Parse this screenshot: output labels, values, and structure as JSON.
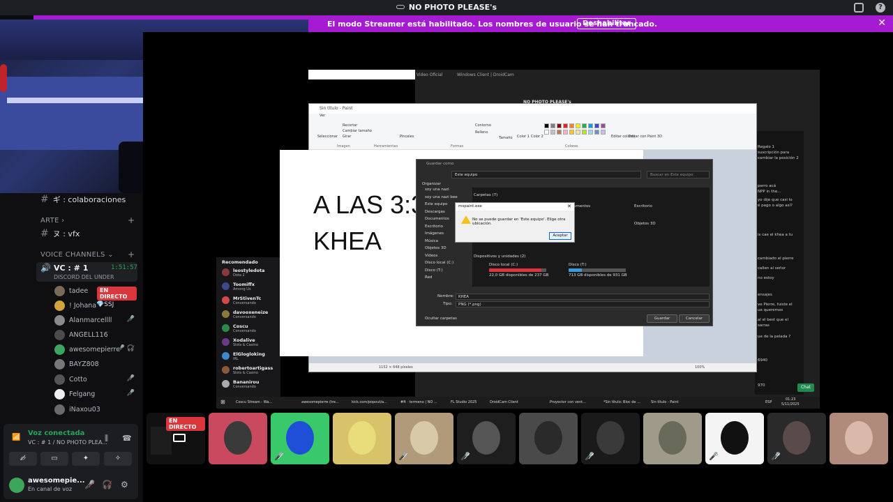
{
  "window": {
    "title": "NO PHOTO PLEASE's"
  },
  "banner": {
    "message": "El modo Streamer está habilitado. Los nombres de usuario se han truncado.",
    "button": "Deshabilitar",
    "close": "✕"
  },
  "channels": [
    {
      "prefix": "#",
      "name": "ギ : colaboraciones"
    },
    {
      "prefix": "#",
      "name": "ヌ : vfx"
    }
  ],
  "categories": {
    "arte": "ARTE",
    "voice": "VOICE CHANNELS"
  },
  "voice_channel": {
    "name": "VC : # 1",
    "timer": "1:51:57",
    "subtitle": "DISCORD DEL UNDER"
  },
  "members": [
    {
      "name": "tadee",
      "badge": "EN DIRECTO",
      "color": "#7a6a5a"
    },
    {
      "name": "! Johana",
      "badge": "💎SSJ",
      "color": "#d4a23a"
    },
    {
      "name": "Alanmarcellll",
      "icon": "🎤̸",
      "color": "#8a8a8a"
    },
    {
      "name": "ANGELL116",
      "color": "#4b4b4b"
    },
    {
      "name": "awesomepierre",
      "icon": "🎤̸ 🎧̸",
      "color": "#3ba55c"
    },
    {
      "name": "BAYZ808",
      "color": "#777777"
    },
    {
      "name": "Cotto",
      "icon": "🎤̸",
      "color": "#555555"
    },
    {
      "name": "Felgang",
      "icon": "🎤̸",
      "color": "#eeeeee"
    },
    {
      "name": "iNaxou03",
      "color": "#6a6a6a"
    }
  ],
  "voice_panel": {
    "status": "Voz conectada",
    "location": "VC : # 1 / NO PHOTO PLEA...",
    "username": "awesomepie...",
    "user_status": "En canal de voz"
  },
  "obs_tabs": [
    "Video Oficial",
    "Windows Client | DroidCam"
  ],
  "obs_preview_title": "NO PHOTO PLEASE's",
  "chat_lines": [
    "Regalo 1",
    "suscripción para",
    "cambiar la posición 2",
    "perro acá",
    "NPP in the...",
    "yo dije que casi lo",
    "é pago o algo así?",
    "is cae el khea a tu",
    "cambiado el pierre",
    "callen al señor",
    "no estoy",
    "ensajes",
    "ve Pierre, fuiste el",
    "ue queremos",
    "al el best que el",
    "sarras",
    "ue de la pelada ?",
    "6940",
    "970"
  ],
  "chat_send": "Chat",
  "recommended": {
    "header": "Recomendado",
    "items": [
      {
        "name": "leostyledota",
        "sub": "Dota 2",
        "color": "#8a3a3a"
      },
      {
        "name": "Toomiffx",
        "sub": "Among Us",
        "color": "#3a4a8a"
      },
      {
        "name": "MrStivenTc",
        "sub": "Conversando",
        "color": "#d04a4a"
      },
      {
        "name": "davooxeneize",
        "sub": "Conversando",
        "color": "#8a7a3a"
      },
      {
        "name": "Coscu",
        "sub": "Conversando",
        "color": "#2a8a4a"
      },
      {
        "name": "Xodalive",
        "sub": "Slots & Casino",
        "color": "#6a3a8a"
      },
      {
        "name": "ElGlogloking",
        "sub": "IRL",
        "color": "#3a8acc"
      },
      {
        "name": "robertoartigass",
        "sub": "Slots & Casino",
        "color": "#8a5a3a"
      },
      {
        "name": "Bananirou",
        "sub": "Conversando",
        "color": "#aaaaaa"
      }
    ]
  },
  "paint": {
    "title": "Sin título - Paint",
    "menu": "Ver",
    "groups": [
      "Imagen",
      "Herramientas",
      "Formas",
      "Colores"
    ],
    "tools": [
      "Recortar",
      "Cambiar tamaño",
      "Girar",
      "Seleccionar",
      "Pinceles",
      "Contorno",
      "Relleno",
      "Tamaño",
      "Color 1",
      "Color 2",
      "Editar colores",
      "Editar con Paint 3D"
    ],
    "canvas_line1": "A LAS 3:3",
    "canvas_line2": "KHEA",
    "status_size": "1152 × 648 píxeles",
    "zoom": "100%",
    "palette": [
      "#000000",
      "#7f7f7f",
      "#880015",
      "#ed1c24",
      "#ff7f27",
      "#fff200",
      "#22b14c",
      "#00a2e8",
      "#3f48cc",
      "#a349a4",
      "#ffffff",
      "#c3c3c3",
      "#b97a57",
      "#ffaec9",
      "#ffc90e",
      "#efe4b0",
      "#b5e61d",
      "#99d9ea",
      "#7092be",
      "#c8bfe7"
    ]
  },
  "save_dialog": {
    "title": "Guardar como",
    "path": "Este equipo",
    "search_placeholder": "Buscar en Este equipo",
    "organize": "Organizar",
    "nav": [
      "soy una nazi",
      "soy una nazi bee",
      "Este equipo",
      "Descargas",
      "Documentos",
      "Escritorio",
      "Imágenes",
      "Música",
      "Objetos 3D",
      "Vídeos",
      "Disco local (C:)",
      "Disco (T:)",
      "Red"
    ],
    "folders_header": "Carpetas (7)",
    "folders": [
      "cumentos",
      "Escritorio",
      "Objetos 3D"
    ],
    "devices_header": "Dispositivos y unidades (2)",
    "drives": [
      {
        "name": "Disco local (C:)",
        "free": "22,0 GB disponibles de 237 GB",
        "used_fraction": 0.91,
        "color": "#da373c"
      },
      {
        "name": "Disco (T:)",
        "free": "713 GB disponibles de 931 GB",
        "used_fraction": 0.23,
        "color": "#3a9ad9"
      }
    ],
    "filename_label": "Nombre:",
    "filename": "KHEA",
    "type_label": "Tipo:",
    "type": "PNG (*.png)",
    "hide_folders": "Ocultar carpetas",
    "save": "Guardar",
    "cancel": "Cancelar"
  },
  "error_box": {
    "title": "mspaint.exe",
    "message": "No se puede guardar en 'Este equipo'. Elige otra ubicación.",
    "ok": "Aceptar"
  },
  "taskbar": {
    "items": [
      "Coscu Stream - Wa...",
      "awesomepierre (tre...",
      "kick.com/popout/a...",
      "#ft · tormeno | NO ...",
      "FL Studio 2025",
      "DroidCam Client",
      "Proyector con vent...",
      "*Sin título: Bloc de ...",
      "Sin título - Paint"
    ],
    "lang": "ESP",
    "time": "01:23",
    "date": "5/11/2025"
  },
  "stream_tile": {
    "live": "EN DIRECTO"
  },
  "tiles": [
    {
      "bg": "#c94a5e",
      "face": "#3a3a3a",
      "muted": false
    },
    {
      "bg": "#39c96b",
      "face": "#1f4fd6",
      "muted": true
    },
    {
      "bg": "#d8c26a",
      "face": "#e9dc7a",
      "muted": false
    },
    {
      "bg": "#b09a7a",
      "face": "#d8c9a8",
      "muted": true
    },
    {
      "bg": "#1e1e1e",
      "face": "#555555",
      "muted": true
    },
    {
      "bg": "#4a4a4a",
      "face": "#2a2a2a",
      "muted": false
    },
    {
      "bg": "#1a1a1a",
      "face": "#3a3a3a",
      "muted": true
    },
    {
      "bg": "#a09a8a",
      "face": "#6a6a5a",
      "muted": false
    },
    {
      "bg": "#f4f4f4",
      "face": "#111111",
      "muted": true
    },
    {
      "bg": "#2a2a2a",
      "face": "#5a4a4a",
      "muted": true
    },
    {
      "bg": "#b08a7a",
      "face": "#d9b9a9",
      "muted": false
    }
  ]
}
